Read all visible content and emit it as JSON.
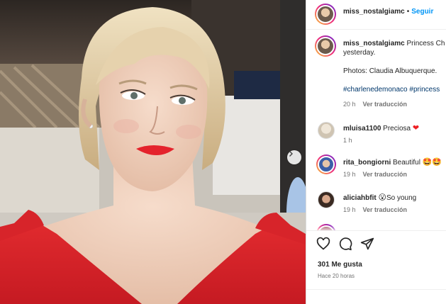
{
  "photo": {
    "description_icon": "carousel-next-icon"
  },
  "post": {
    "username": "miss_nostalgiamc",
    "separator": "•",
    "follow_label": "Seguir",
    "caption_username": "miss_nostalgiamc",
    "caption_line1": "Princess Ch",
    "caption_line2": "yesterday.",
    "caption_credit": "Photos: Claudia Albuquerque.",
    "hashtags": "#charlenedemonaco #princess",
    "time": "20 h",
    "translate": "Ver traducción"
  },
  "comments": [
    {
      "username": "mluisa1100",
      "text": "Preciosa",
      "emoji": "❤",
      "time": "1 h",
      "translate": ""
    },
    {
      "username": "rita_bongiorni",
      "text": "Beautiful",
      "emoji": "🤩🤩",
      "time": "19 h",
      "translate": "Ver traducción"
    },
    {
      "username": "aliciahbfit",
      "text": "So young",
      "emoji": "😮",
      "time": "19 h",
      "translate": "Ver traducción"
    }
  ],
  "actions": {
    "like_icon": "heart-icon",
    "comment_icon": "comment-icon",
    "share_icon": "share-icon"
  },
  "likes_text": "301 Me gusta",
  "posted_text": "Hace 20 horas",
  "colors": {
    "follow": "#0095f6",
    "hashtag": "#00376b",
    "dress": "#d51f26"
  }
}
